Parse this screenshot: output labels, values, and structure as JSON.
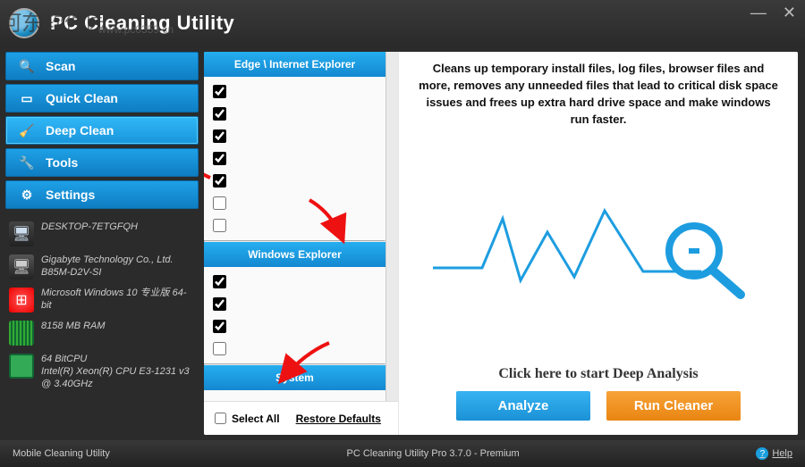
{
  "title": "PC Cleaning Utility",
  "watermark": "河东软件园",
  "watermark_url": "www.pc0359.cn",
  "nav": {
    "scan": "Scan",
    "quick": "Quick Clean",
    "deep": "Deep Clean",
    "tools": "Tools",
    "settings": "Settings"
  },
  "sysinfo": {
    "hostname": "DESKTOP-7ETGFQH",
    "motherboard": "Gigabyte Technology Co., Ltd. B85M-D2V-SI",
    "os": "Microsoft Windows 10 专业版 64-bit",
    "ram": "8158 MB RAM",
    "cpu": "64 BitCPU\nIntel(R) Xeon(R) CPU E3-1231 v3 @ 3.40GHz"
  },
  "sections": {
    "edge": "Edge \\ Internet Explorer",
    "winexp": "Windows Explorer",
    "system": "System"
  },
  "select_all": "Select All",
  "restore_defaults": "Restore Defaults",
  "description": "Cleans up temporary install files, log files, browser files and more, removes any unneeded files that lead to critical disk space issues and frees up extra hard drive space and make windows run faster.",
  "hint": "Click here to start Deep Analysis",
  "actions": {
    "analyze": "Analyze",
    "run": "Run Cleaner"
  },
  "status": {
    "left": "Mobile Cleaning Utility",
    "center": "PC Cleaning Utility Pro 3.7.0 - Premium",
    "help": "Help"
  },
  "checks": {
    "edge": [
      true,
      true,
      true,
      true,
      true,
      false,
      false
    ],
    "winexp": [
      true,
      true,
      true,
      false
    ]
  }
}
